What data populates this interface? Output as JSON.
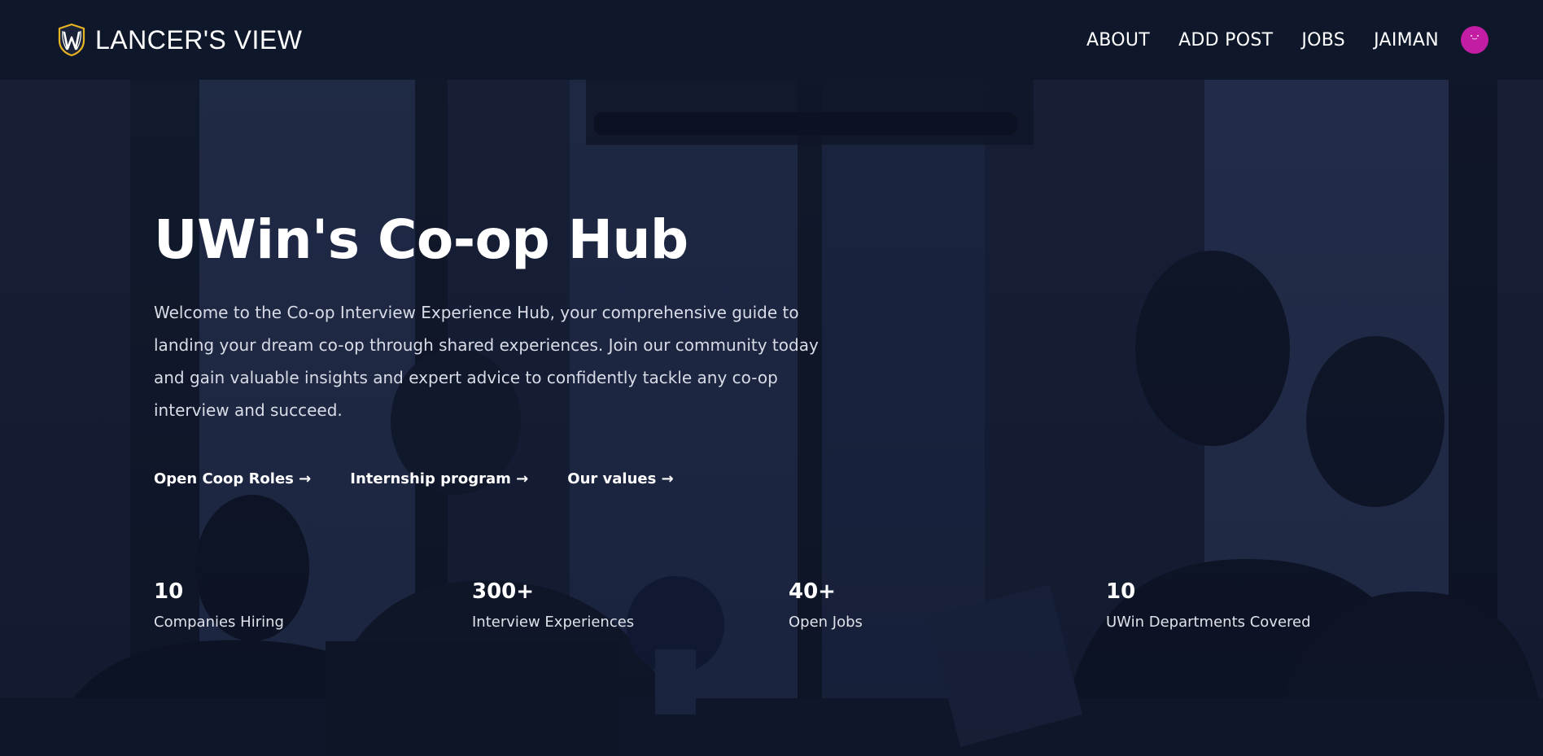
{
  "navbar": {
    "brand_name": "LANCER'S VIEW",
    "brand_logo_icon": "shield-w-icon",
    "links": [
      {
        "label": "ABOUT"
      },
      {
        "label": "ADD POST"
      },
      {
        "label": "JOBS"
      },
      {
        "label": "JAIMAN"
      }
    ],
    "avatar_color": "#c21da3"
  },
  "hero": {
    "title": "UWin's Co-op Hub",
    "description": "Welcome to the Co-op Interview Experience Hub, your comprehensive guide to landing your dream co-op through shared experiences. Join our community today and gain valuable insights and expert advice to confidently tackle any co-op interview and succeed.",
    "links": [
      {
        "label": "Open Coop Roles →"
      },
      {
        "label": "Internship program →"
      },
      {
        "label": "Our values →"
      }
    ],
    "stats": [
      {
        "value": "10",
        "label": "Companies Hiring"
      },
      {
        "value": "300+",
        "label": "Interview Experiences"
      },
      {
        "value": "40+",
        "label": "Open Jobs"
      },
      {
        "value": "10",
        "label": "UWin Departments Covered"
      }
    ]
  },
  "colors": {
    "navbar_bg": "#0f172a",
    "hero_overlay": "#10182c",
    "accent_avatar": "#c21da3",
    "logo_gold": "#e6b422"
  }
}
